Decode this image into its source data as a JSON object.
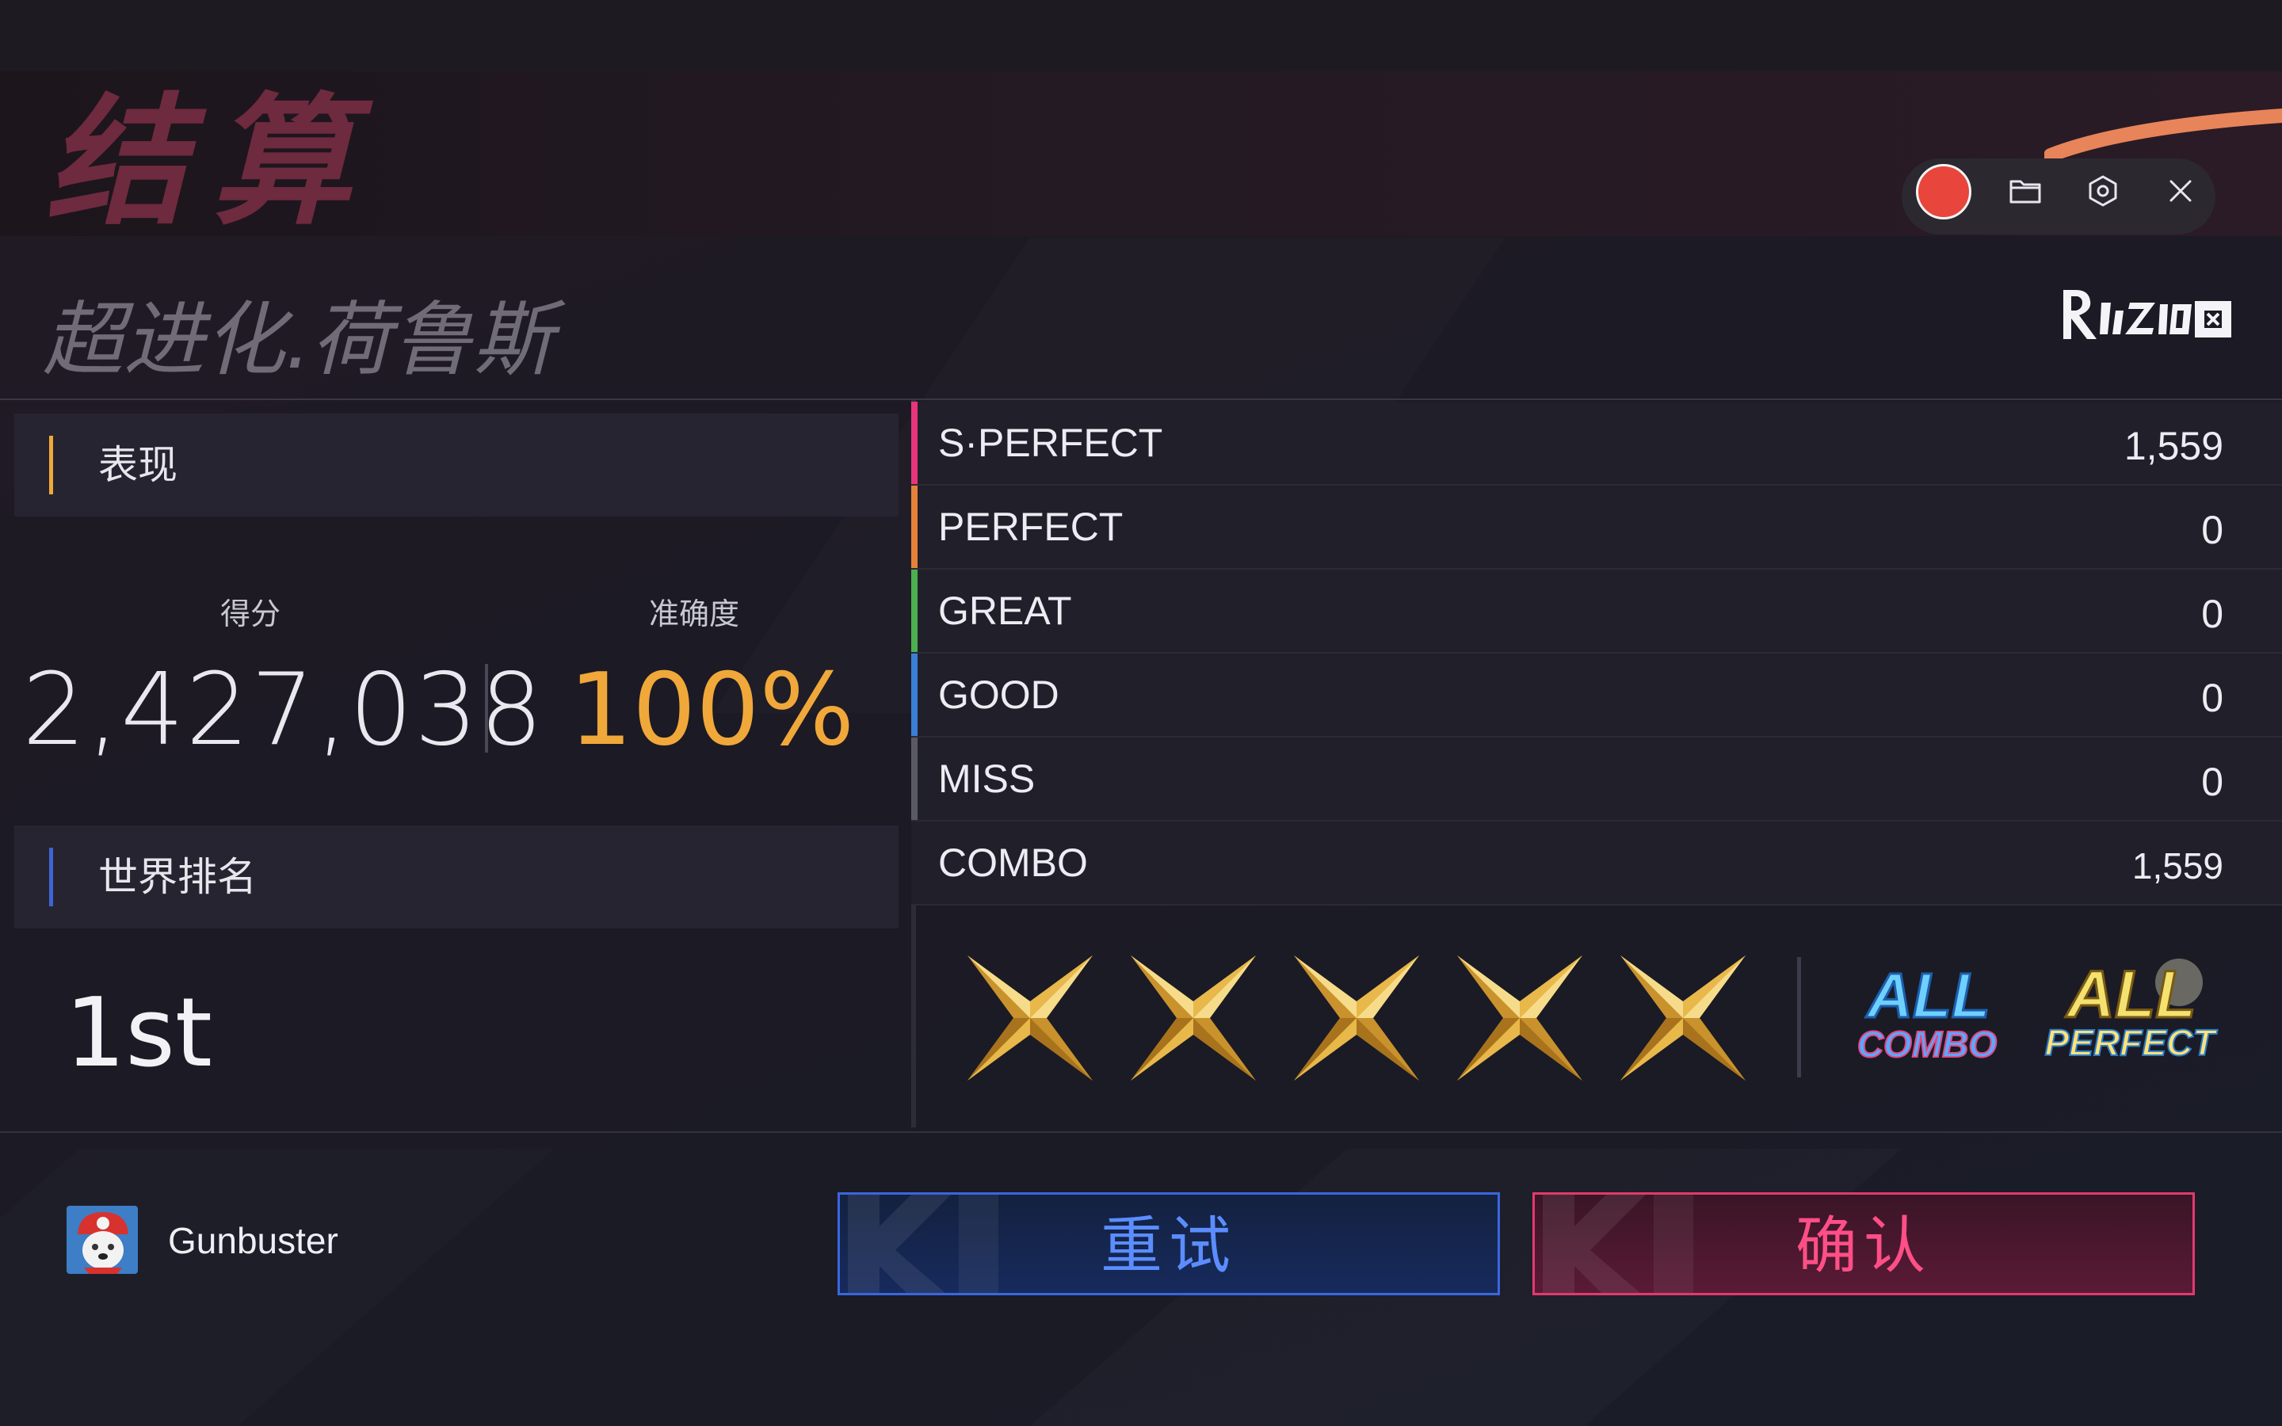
{
  "header": {
    "title": "结算",
    "song_title": "超进化.荷鲁斯",
    "brand": "Rizline-style logo"
  },
  "recorder": {
    "record_icon": "record-dot",
    "folder_icon": "folder-icon",
    "settings_icon": "settings-icon",
    "close_icon": "close-icon",
    "accent_color": "#e8453c"
  },
  "performance": {
    "label": "表现",
    "accent_color": "#f0a83a",
    "score_label": "得分",
    "score_value": "2,427,038",
    "accuracy_label": "准确度",
    "accuracy_value": "100%"
  },
  "world_rank": {
    "label": "世界排名",
    "accent_color": "#3f63d6",
    "value": "1st"
  },
  "judgements": [
    {
      "name": "S·PERFECT",
      "count": "1,559",
      "color": "#e8357a"
    },
    {
      "name": "PERFECT",
      "count": "0",
      "color": "#e6813a"
    },
    {
      "name": "GREAT",
      "count": "0",
      "color": "#4caf50"
    },
    {
      "name": "GOOD",
      "count": "0",
      "color": "#3a7fd6"
    },
    {
      "name": "MISS",
      "count": "0",
      "color": "#5a5a66"
    },
    {
      "name": "COMBO",
      "count": "1,559",
      "color": "#211f29"
    }
  ],
  "rating": {
    "stars": 5,
    "max_stars": 5,
    "star_color": "#e8b84a",
    "badges": [
      "ALL COMBO",
      "ALL PERFECT"
    ]
  },
  "player": {
    "name": "Gunbuster",
    "avatar_icon": "avatar-icon"
  },
  "actions": {
    "retry_label": "重试",
    "confirm_label": "确认"
  }
}
